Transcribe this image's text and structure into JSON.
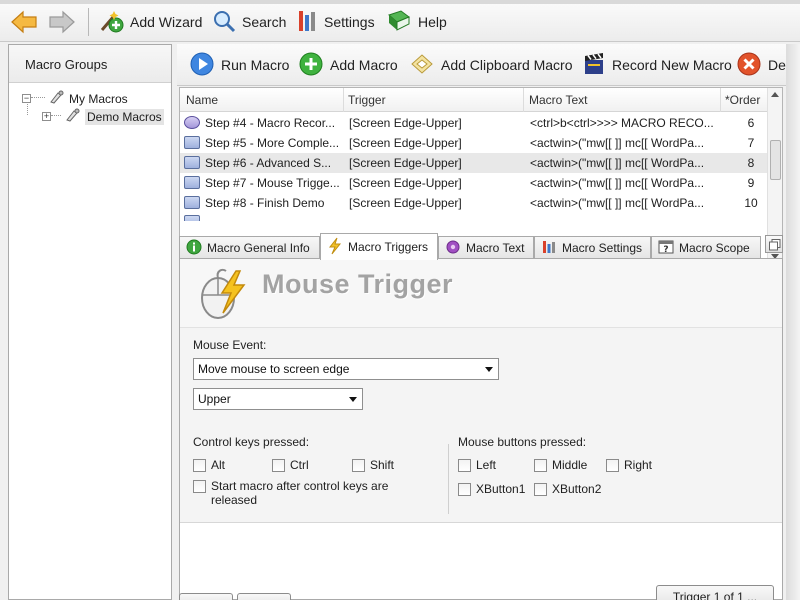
{
  "toolbar": {
    "add_wizard": "Add Wizard",
    "search": "Search",
    "settings": "Settings",
    "help": "Help"
  },
  "left_panel": {
    "header": "Macro Groups",
    "tree": [
      {
        "label": "My Macros",
        "expander": "−"
      },
      {
        "label": "Demo Macros",
        "expander": "+"
      }
    ]
  },
  "actions": {
    "run_macro": "Run Macro",
    "add_macro": "Add Macro",
    "add_clipboard_macro": "Add Clipboard Macro",
    "record_new_macro": "Record New Macro",
    "delete": "Dele"
  },
  "macro_list": {
    "columns": [
      "Name",
      "Trigger",
      "Macro Text",
      "*Order"
    ],
    "rows": [
      {
        "name": "Step #4 - Macro Recor...",
        "trigger": "[Screen Edge-Upper]",
        "text": "<ctrl>b<ctrl>>>> MACRO RECO...",
        "order": "6"
      },
      {
        "name": "Step #5 - More Comple...",
        "trigger": "[Screen Edge-Upper]",
        "text": "<actwin>(\"mw[[ ]] mc[[ WordPa...",
        "order": "7"
      },
      {
        "name": "Step #6 - Advanced S...",
        "trigger": "[Screen Edge-Upper]",
        "text": "<actwin>(\"mw[[ ]] mc[[ WordPa...",
        "order": "8"
      },
      {
        "name": "Step #7 - Mouse Trigge...",
        "trigger": "[Screen Edge-Upper]",
        "text": "<actwin>(\"mw[[ ]] mc[[ WordPa...",
        "order": "9"
      },
      {
        "name": "Step #8 - Finish Demo",
        "trigger": "[Screen Edge-Upper]",
        "text": "<actwin>(\"mw[[ ]] mc[[ WordPa...",
        "order": "10"
      }
    ]
  },
  "tabs": [
    "Macro General Info",
    "Macro Triggers",
    "Macro Text",
    "Macro Settings",
    "Macro Scope"
  ],
  "trigger_panel": {
    "title": "Mouse Trigger",
    "mouse_event_label": "Mouse Event:",
    "mouse_event_value": "Move mouse to screen edge",
    "edge_value": "Upper",
    "control_keys_label": "Control keys pressed:",
    "control_keys": [
      "Alt",
      "Ctrl",
      "Shift"
    ],
    "start_after_release": "Start macro after control keys are released",
    "mouse_buttons_label": "Mouse buttons pressed:",
    "mouse_buttons": [
      "Left",
      "Middle",
      "Right",
      "XButton1",
      "XButton2"
    ],
    "trigger_count_button": "Trigger 1 of 1 ..."
  },
  "colors": {
    "accent_blue": "#2f6fd6",
    "selection_gray": "#e8e8e8",
    "banner_text": "#a3a3a3"
  }
}
